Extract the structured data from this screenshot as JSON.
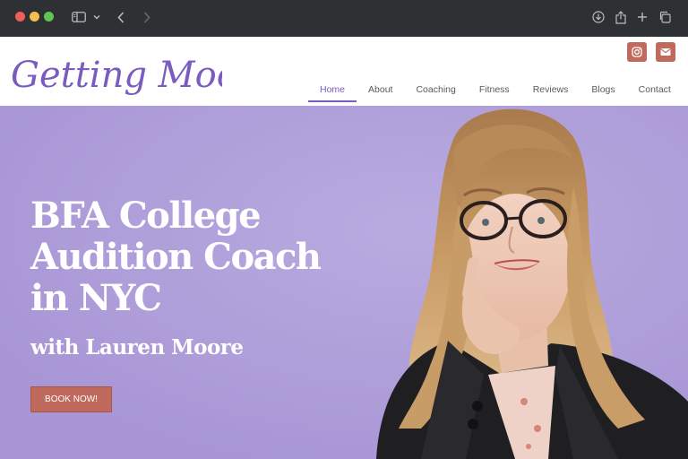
{
  "site": {
    "logo_text": "Getting Moore",
    "brand_color": "#7a5cc0",
    "accent_color": "#c06a5d",
    "hero_background": "#af9fd9"
  },
  "browser": {
    "icons": [
      "sidebar-toggle-icon",
      "chevron-down-icon",
      "back-icon",
      "forward-icon",
      "download-icon",
      "share-icon",
      "new-tab-icon",
      "tabs-overview-icon"
    ]
  },
  "social": {
    "icons": [
      "instagram-icon",
      "email-icon"
    ]
  },
  "nav": {
    "items": [
      {
        "label": "Home",
        "active": true
      },
      {
        "label": "About",
        "active": false
      },
      {
        "label": "Coaching",
        "active": false
      },
      {
        "label": "Fitness",
        "active": false
      },
      {
        "label": "Reviews",
        "active": false
      },
      {
        "label": "Blogs",
        "active": false
      },
      {
        "label": "Contact",
        "active": false
      }
    ]
  },
  "hero": {
    "title_lines": [
      "BFA College",
      "Audition Coach",
      "in NYC"
    ],
    "subtitle": "with Lauren Moore",
    "cta_label": "BOOK NOW!"
  }
}
